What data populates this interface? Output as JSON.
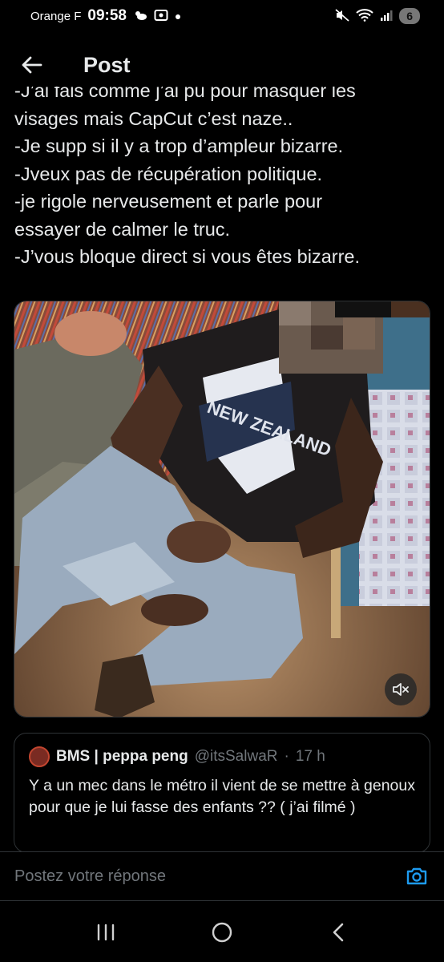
{
  "status_bar": {
    "carrier": "Orange F",
    "time": "09:58",
    "battery": "6",
    "icons": [
      "weather-icon",
      "screenshot-icon",
      "dot-icon",
      "mute-icon",
      "wifi-icon",
      "signal-icon"
    ]
  },
  "header": {
    "title": "Post",
    "back_icon": "arrow-left-icon"
  },
  "post": {
    "lines": [
      "-J’ai fais comme j’ai pu pour masquer les",
      "visages mais CapCut c’est naze..",
      "-Je supp si il y a trop d’ampleur bizarre.",
      "-Jveux pas de récupération politique.",
      "-je rigole nerveusement et parle pour",
      "essayer de calmer le truc.",
      "-J’vous bloque direct si vous êtes bizarre."
    ]
  },
  "media": {
    "type": "video",
    "shirt_text": "NEW ZEALAND",
    "mute_icon": "volume-muted-icon"
  },
  "quote": {
    "name": "BMS | peppa peng",
    "handle": "@itsSalwaR",
    "separator": "·",
    "time": "17 h",
    "text": "Y a un mec dans le métro il vient de se mettre à genoux pour que je lui fasse des enfants ?? ( j’ai filmé )"
  },
  "reply": {
    "placeholder": "Postez votre réponse",
    "camera_icon": "camera-icon"
  },
  "nav": {
    "recents_icon": "recents-icon",
    "home_icon": "home-icon",
    "back_icon": "back-icon"
  },
  "colors": {
    "background": "#000000",
    "text": "#e7e9ea",
    "secondary_text": "#71767b",
    "border": "#2f3336",
    "accent": "#1d9bf0"
  }
}
